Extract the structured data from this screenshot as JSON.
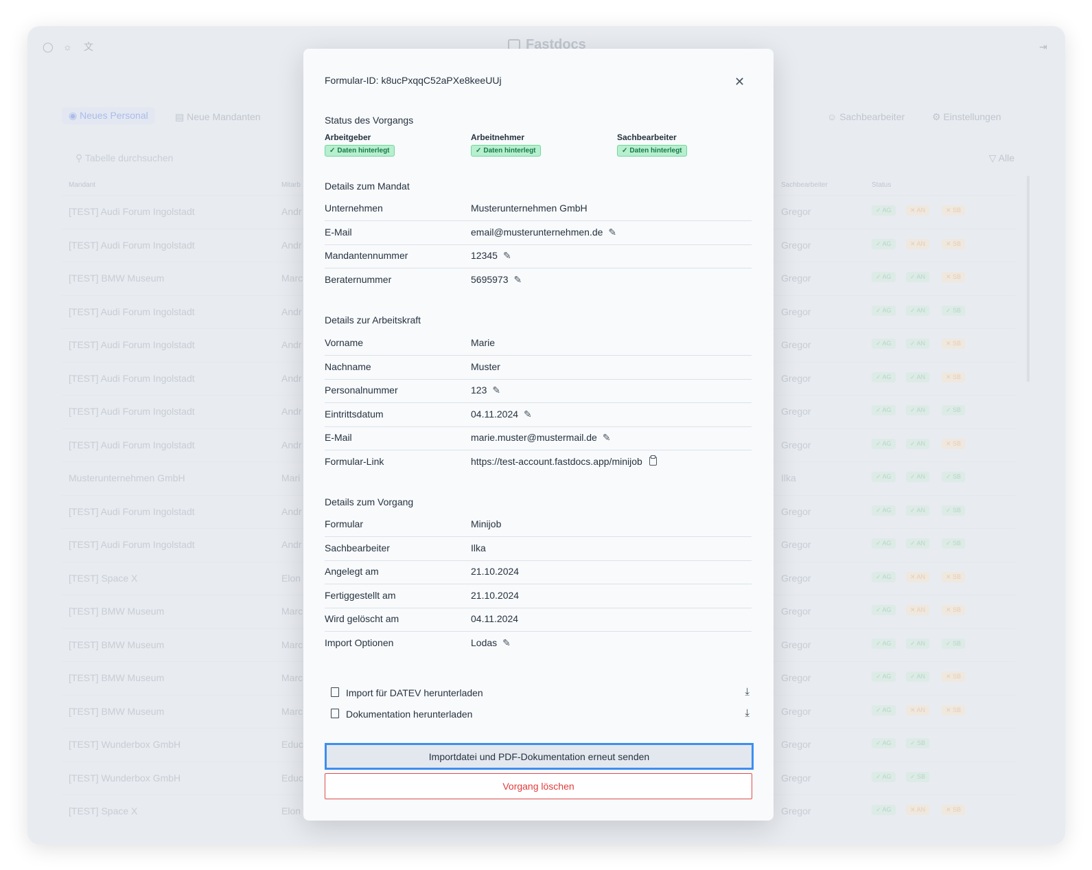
{
  "app": {
    "brand": "Fastdocs",
    "nav": {
      "items": [
        "Neues Personal",
        "Neue Mandanten"
      ],
      "right_items": [
        "Sachbearbeiter",
        "Einstellungen"
      ]
    },
    "search_placeholder": "Tabelle durchsuchen",
    "filter_label": "Alle",
    "table": {
      "headers": [
        "Mandant",
        "Mitarb",
        "Sachbearbeiter",
        "Status"
      ],
      "rows": [
        {
          "mandant": "[TEST] Audi Forum Ingolstadt",
          "mitarb": "Andr",
          "sb": "Gregor",
          "status": [
            [
              "AG",
              1
            ],
            [
              "AN",
              0
            ],
            [
              "SB",
              0
            ]
          ]
        },
        {
          "mandant": "[TEST] Audi Forum Ingolstadt",
          "mitarb": "Andr",
          "sb": "Gregor",
          "status": [
            [
              "AG",
              1
            ],
            [
              "AN",
              0
            ],
            [
              "SB",
              0
            ]
          ]
        },
        {
          "mandant": "[TEST] BMW Museum",
          "mitarb": "Marc",
          "sb": "Gregor",
          "status": [
            [
              "AG",
              1
            ],
            [
              "AN",
              1
            ],
            [
              "SB",
              0
            ]
          ]
        },
        {
          "mandant": "[TEST] Audi Forum Ingolstadt",
          "mitarb": "Andr",
          "sb": "Gregor",
          "status": [
            [
              "AG",
              1
            ],
            [
              "AN",
              1
            ],
            [
              "SB",
              1
            ]
          ]
        },
        {
          "mandant": "[TEST] Audi Forum Ingolstadt",
          "mitarb": "Andr",
          "sb": "Gregor",
          "status": [
            [
              "AG",
              1
            ],
            [
              "AN",
              1
            ],
            [
              "SB",
              0
            ]
          ]
        },
        {
          "mandant": "[TEST] Audi Forum Ingolstadt",
          "mitarb": "Andr",
          "sb": "Gregor",
          "status": [
            [
              "AG",
              1
            ],
            [
              "AN",
              1
            ],
            [
              "SB",
              0
            ]
          ]
        },
        {
          "mandant": "[TEST] Audi Forum Ingolstadt",
          "mitarb": "Andr",
          "sb": "Gregor",
          "status": [
            [
              "AG",
              1
            ],
            [
              "AN",
              1
            ],
            [
              "SB",
              1
            ]
          ]
        },
        {
          "mandant": "[TEST] Audi Forum Ingolstadt",
          "mitarb": "Andr",
          "sb": "Gregor",
          "status": [
            [
              "AG",
              1
            ],
            [
              "AN",
              1
            ],
            [
              "SB",
              0
            ]
          ]
        },
        {
          "mandant": "Musterunternehmen GmbH",
          "mitarb": "Mari",
          "sb": "Ilka",
          "status": [
            [
              "AG",
              1
            ],
            [
              "AN",
              1
            ],
            [
              "SB",
              1
            ]
          ]
        },
        {
          "mandant": "[TEST] Audi Forum Ingolstadt",
          "mitarb": "Andr",
          "sb": "Gregor",
          "status": [
            [
              "AG",
              1
            ],
            [
              "AN",
              1
            ],
            [
              "SB",
              1
            ]
          ]
        },
        {
          "mandant": "[TEST] Audi Forum Ingolstadt",
          "mitarb": "Andr",
          "sb": "Gregor",
          "status": [
            [
              "AG",
              1
            ],
            [
              "AN",
              1
            ],
            [
              "SB",
              1
            ]
          ]
        },
        {
          "mandant": "[TEST] Space X",
          "mitarb": "Elon",
          "sb": "Gregor",
          "status": [
            [
              "AG",
              1
            ],
            [
              "AN",
              0
            ],
            [
              "SB",
              0
            ]
          ]
        },
        {
          "mandant": "[TEST] BMW Museum",
          "mitarb": "Marc",
          "sb": "Gregor",
          "status": [
            [
              "AG",
              1
            ],
            [
              "AN",
              0
            ],
            [
              "SB",
              0
            ]
          ]
        },
        {
          "mandant": "[TEST] BMW Museum",
          "mitarb": "Marc",
          "sb": "Gregor",
          "status": [
            [
              "AG",
              1
            ],
            [
              "AN",
              1
            ],
            [
              "SB",
              1
            ]
          ]
        },
        {
          "mandant": "[TEST] BMW Museum",
          "mitarb": "Marc",
          "sb": "Gregor",
          "status": [
            [
              "AG",
              1
            ],
            [
              "AN",
              1
            ],
            [
              "SB",
              0
            ]
          ]
        },
        {
          "mandant": "[TEST] BMW Museum",
          "mitarb": "Marc",
          "sb": "Gregor",
          "status": [
            [
              "AG",
              1
            ],
            [
              "AN",
              0
            ],
            [
              "SB",
              0
            ]
          ]
        },
        {
          "mandant": "[TEST] Wunderbox GmbH",
          "mitarb": "Educ",
          "sb": "Gregor",
          "status": [
            [
              "AG",
              1
            ],
            [
              "SB",
              1
            ]
          ]
        },
        {
          "mandant": "[TEST] Wunderbox GmbH",
          "mitarb": "Educ",
          "sb": "Gregor",
          "status": [
            [
              "AG",
              1
            ],
            [
              "SB",
              1
            ]
          ]
        },
        {
          "mandant": "[TEST] Space X",
          "mitarb": "Elon",
          "sb": "Gregor",
          "status": [
            [
              "AG",
              1
            ],
            [
              "AN",
              0
            ],
            [
              "SB",
              0
            ]
          ]
        }
      ]
    }
  },
  "modal": {
    "title": "Formular-ID: k8ucPxqqC52aPXe8keeUUj",
    "status_section": "Status des Vorgangs",
    "parties": [
      {
        "label": "Arbeitgeber",
        "status": "Daten hinterlegt"
      },
      {
        "label": "Arbeitnehmer",
        "status": "Daten hinterlegt"
      },
      {
        "label": "Sachbearbeiter",
        "status": "Daten hinterlegt"
      }
    ],
    "mandat": {
      "heading": "Details zum Mandat",
      "rows": [
        {
          "label": "Unternehmen",
          "value": "Musterunternehmen GmbH",
          "edit": false
        },
        {
          "label": "E-Mail",
          "value": "email@musterunternehmen.de",
          "edit": true
        },
        {
          "label": "Mandantennummer",
          "value": "12345",
          "edit": true
        },
        {
          "label": "Beraternummer",
          "value": "5695973",
          "edit": true
        }
      ]
    },
    "arbeitskraft": {
      "heading": "Details zur Arbeitskraft",
      "rows": [
        {
          "label": "Vorname",
          "value": "Marie",
          "edit": false
        },
        {
          "label": "Nachname",
          "value": "Muster",
          "edit": false
        },
        {
          "label": "Personalnummer",
          "value": "123",
          "edit": true
        },
        {
          "label": "Eintrittsdatum",
          "value": "04.11.2024",
          "edit": true
        },
        {
          "label": "E-Mail",
          "value": "marie.muster@mustermail.de",
          "edit": true
        },
        {
          "label": "Formular-Link",
          "value": "https://test-account.fastdocs.app/minijob",
          "copy": true
        }
      ]
    },
    "vorgang": {
      "heading": "Details zum Vorgang",
      "rows": [
        {
          "label": "Formular",
          "value": "Minijob",
          "edit": false
        },
        {
          "label": "Sachbearbeiter",
          "value": "Ilka",
          "edit": false
        },
        {
          "label": "Angelegt am",
          "value": "21.10.2024",
          "edit": false
        },
        {
          "label": "Fertiggestellt am",
          "value": "21.10.2024",
          "edit": false
        },
        {
          "label": "Wird gelöscht am",
          "value": "04.11.2024",
          "edit": false
        },
        {
          "label": "Import Optionen",
          "value": "Lodas",
          "edit": true
        }
      ]
    },
    "downloads": [
      "Import für DATEV herunterladen",
      "Dokumentation herunterladen"
    ],
    "resend_label": "Importdatei und PDF-Dokumentation erneut senden",
    "delete_label": "Vorgang löschen"
  },
  "colors": {
    "accent_focus": "#3d8ef0",
    "danger": "#e03b3b",
    "success_bg": "#b7efcf",
    "success_text": "#167a4a"
  }
}
